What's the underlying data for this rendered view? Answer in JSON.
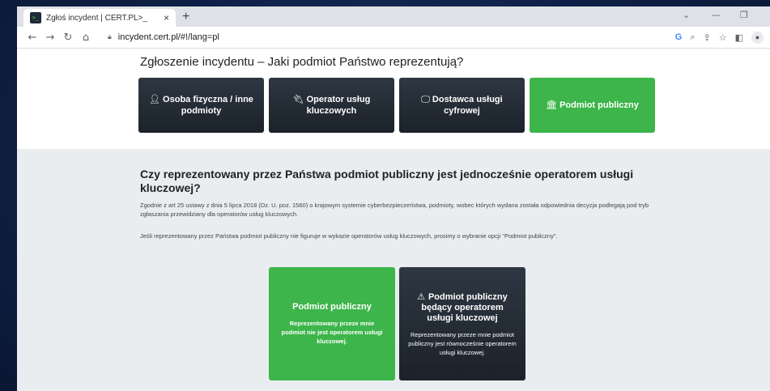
{
  "browser": {
    "tab_title": "Zgłoś incydent | CERT.PL>_",
    "favicon_text": ">_",
    "new_tab": "+",
    "close": "×",
    "url": "incydent.cert.pl/#!/lang=pl",
    "minimize": "—",
    "restore": "❐",
    "collapse": "⌄",
    "google_letter": "G"
  },
  "header": {
    "title": "Zgłoszenie incydentu – Jaki podmiot Państwo reprezentują?"
  },
  "choices": [
    {
      "label": "Osoba fizyczna / inne podmioty",
      "icon": "person-icon",
      "selected": false
    },
    {
      "label": "Operator usług kluczowych",
      "icon": "plug-icon",
      "selected": false
    },
    {
      "label": "Dostawca usługi cyfrowej",
      "icon": "desktop-icon",
      "selected": false
    },
    {
      "label": "Podmiot publiczny",
      "icon": "bank-icon",
      "selected": true
    }
  ],
  "question": {
    "title": "Czy reprezentowany przez Państwa podmiot publiczny jest jednocześnie operatorem usługi kluczowej?",
    "paragraph1": "Zgodnie z art 25 ustawy z dnia 5 lipca 2018 (Dz. U. poz. 1560) o krajowym systemie cyberbezpieczeństwa, podmioty, wobec których wydana została odpowiednia decyzja podlegają pod tryb zgłaszania przewidziany dla operatorów usług kluczowych.",
    "paragraph2": "Jeśli reprezentowany przez Państwa podmiot publiczny nie figuruje w wykazie operatorów usług kluczowych, prosimy o wybranie opcji \"Podmiot publiczny\"."
  },
  "cards": [
    {
      "title": "Podmiot publiczny",
      "description": "Reprezentowany przeze mnie podmiot nie jest operatorem usługi kluczowej."
    },
    {
      "title": "Podmiot publiczny będący operatorem usługi kluczowej",
      "description": "Reprezentowany przeze mnie podmiot publiczny jest równocześnie operatorem usługi kluczowej."
    }
  ],
  "colors": {
    "green": "#3db54a",
    "dark": "#1b222b",
    "gray_bg": "#eaedf0"
  }
}
